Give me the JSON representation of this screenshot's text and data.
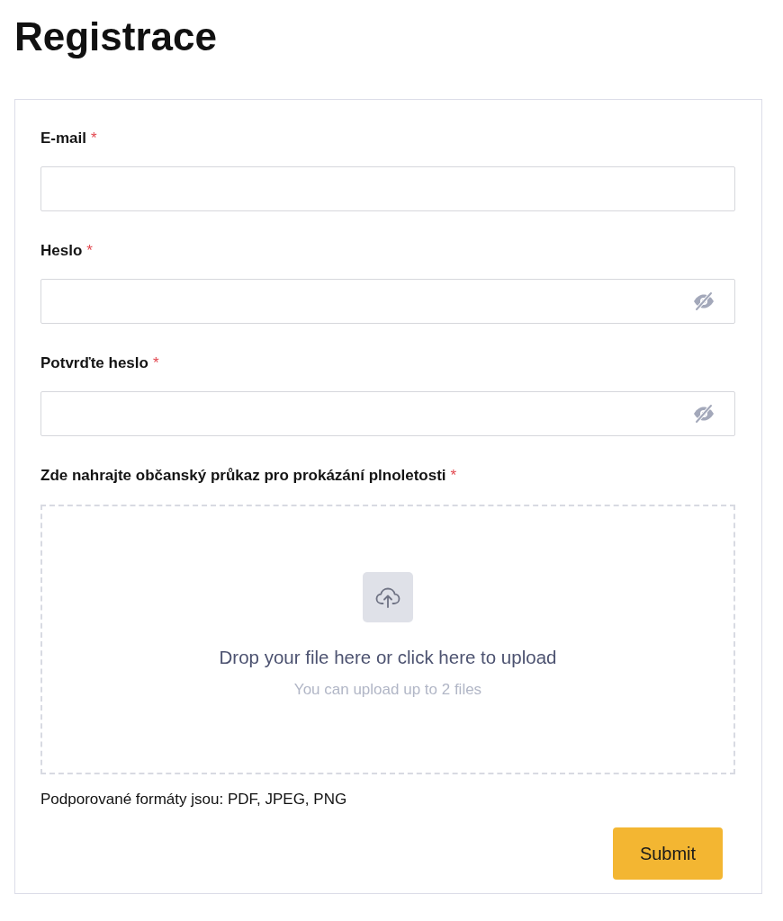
{
  "page": {
    "title": "Registrace"
  },
  "form": {
    "fields": [
      {
        "kind": "email",
        "label": "E-mail",
        "required_mark": "*"
      },
      {
        "kind": "password",
        "label": "Heslo",
        "required_mark": "*",
        "revealed": false
      },
      {
        "kind": "password",
        "label": "Potvrďte heslo",
        "required_mark": "*",
        "revealed": false
      }
    ],
    "upload": {
      "label": "Zde nahrajte občanský průkaz pro prokázání plnoletosti",
      "required_mark": "*",
      "prompt": "Drop your file here or click here to upload",
      "hint": "You can upload up to 2 files"
    },
    "formats_note": "Podporované formáty jsou: PDF, JPEG, PNG",
    "submit_button": {
      "label": "Submit"
    }
  }
}
